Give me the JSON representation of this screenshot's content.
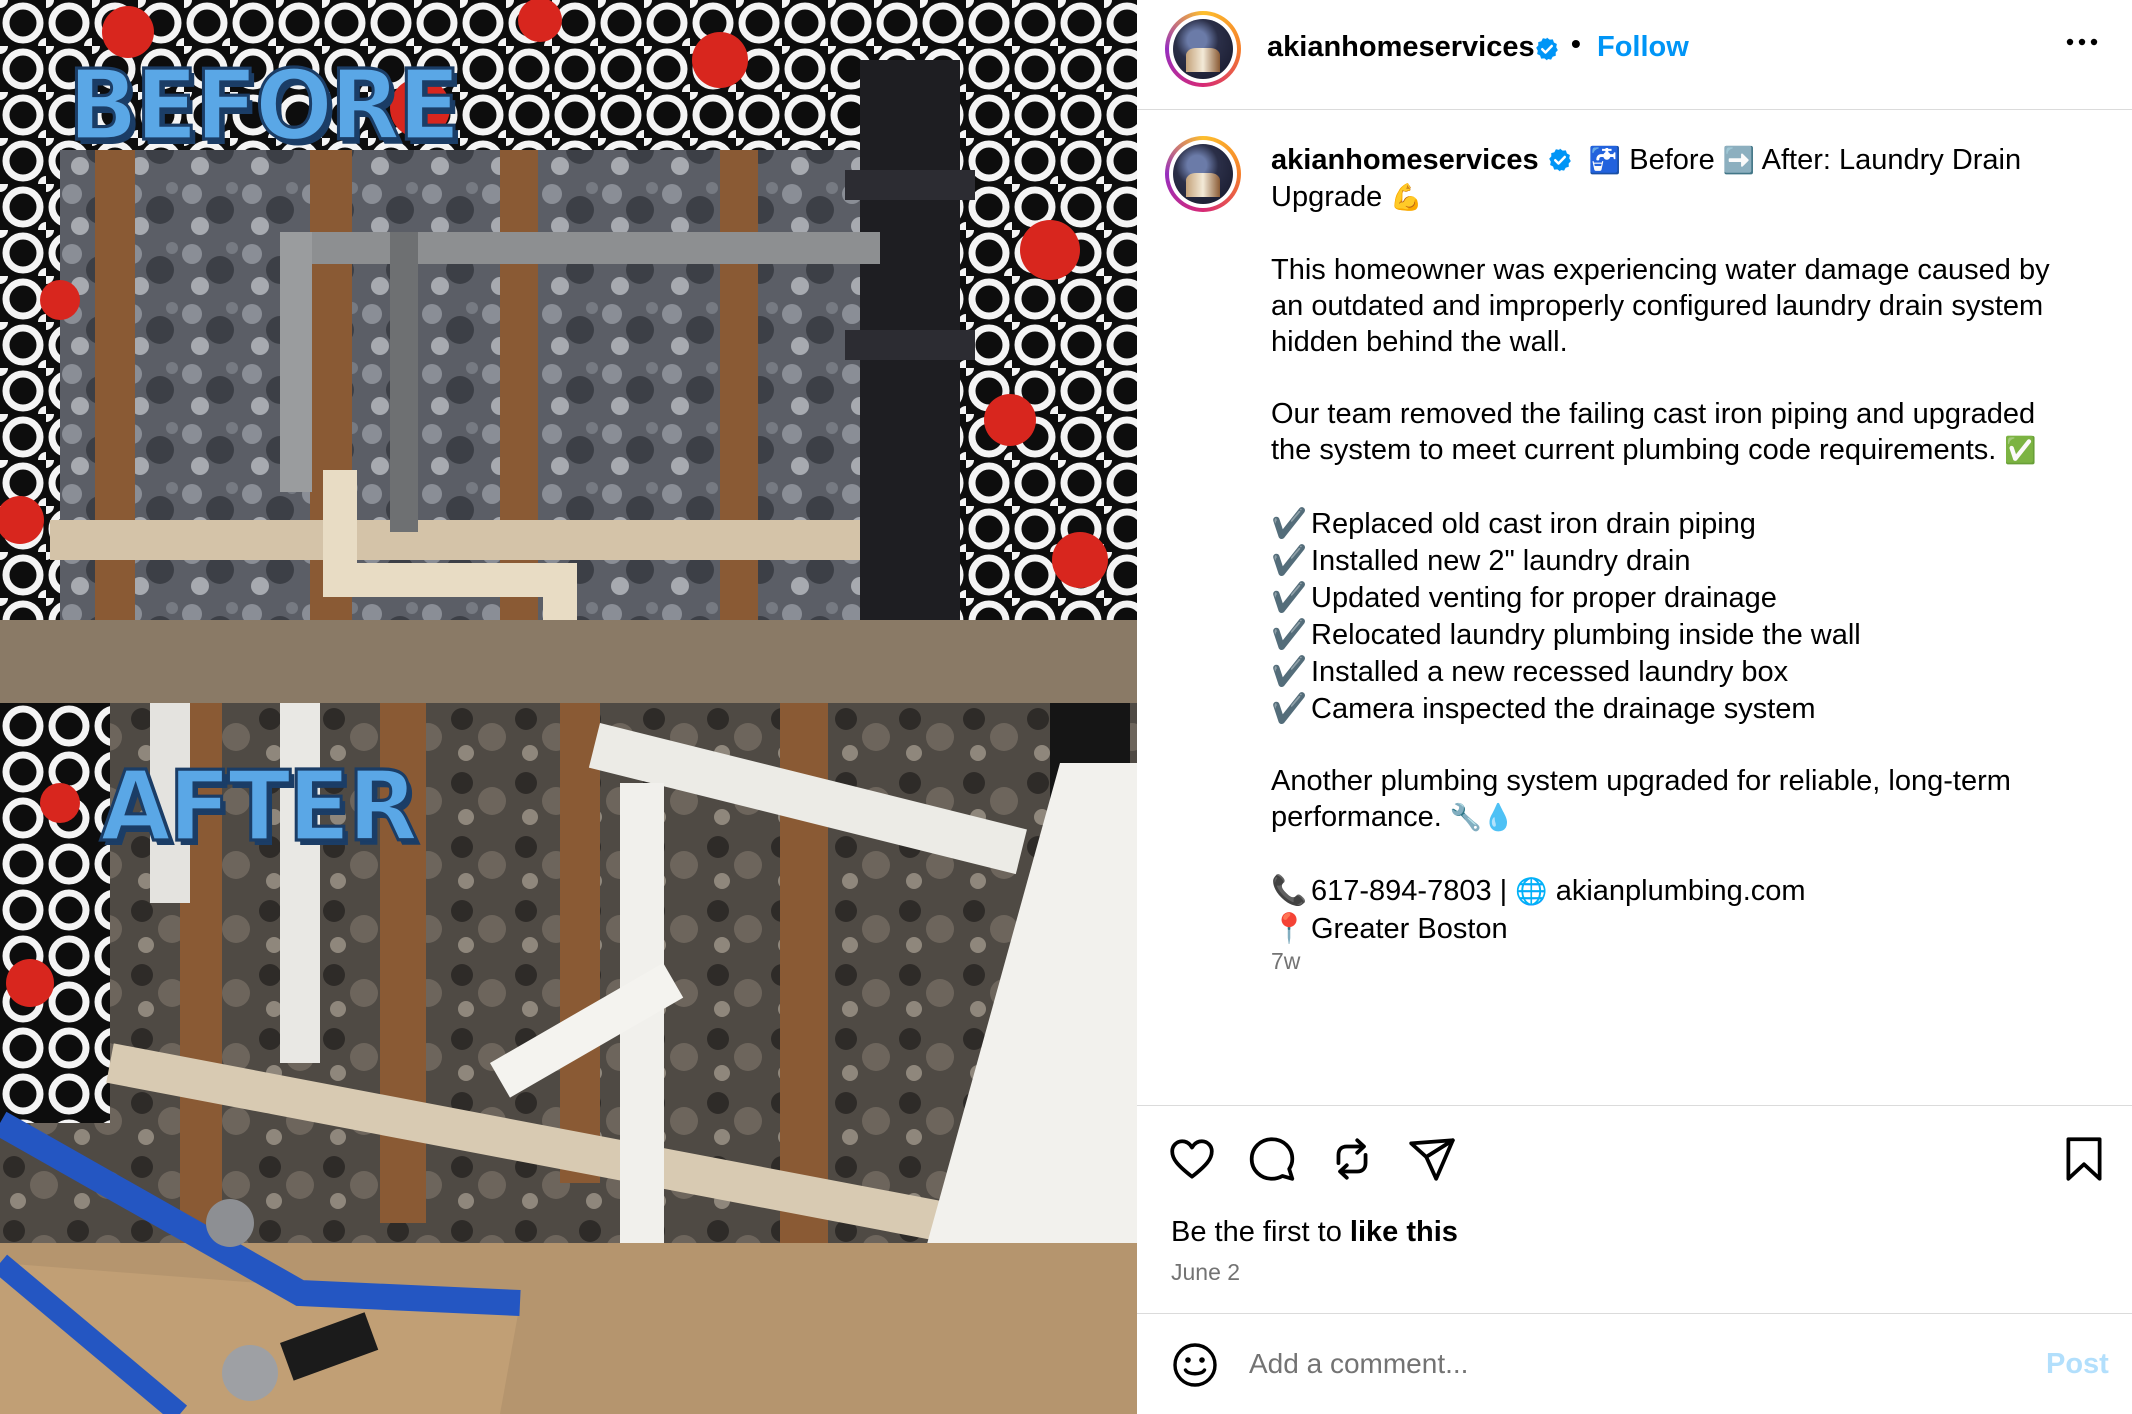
{
  "media": {
    "before_label": "BEFORE",
    "after_label": "AFTER"
  },
  "header": {
    "username": "akianhomeservices",
    "separator": "•",
    "follow_label": "Follow",
    "more_icon": "more-options-icon"
  },
  "caption": {
    "username": "akianhomeservices",
    "title_parts": {
      "faucet_emoji": "🚰",
      "before": "Before",
      "arrow_emoji": "➡️",
      "after": "After: Laundry Drain",
      "line2": "Upgrade",
      "muscle_emoji": "💪"
    },
    "paragraph1": [
      "This homeowner was experiencing water damage caused by",
      "an outdated and improperly configured laundry drain system",
      "hidden behind the wall."
    ],
    "paragraph2": [
      "Our team removed the failing cast iron piping and upgraded",
      "the system to meet current plumbing code requirements."
    ],
    "check_emoji": "✅",
    "tick_mark": "✔️",
    "checklist": [
      "Replaced old cast iron drain piping",
      "Installed new 2\" laundry drain",
      "Updated venting for proper drainage",
      "Relocated laundry plumbing inside the wall",
      "Installed a new recessed laundry box",
      "Camera inspected the drainage system"
    ],
    "closing": [
      "Another plumbing system upgraded for reliable, long-term",
      "performance."
    ],
    "closing_emojis": [
      "🔧",
      "💧"
    ],
    "contact": {
      "phone_emoji": "📞",
      "phone": "617-894-7803 |",
      "globe_emoji": "🌐",
      "website": "akianplumbing.com",
      "pin_emoji": "📍",
      "location": "Greater Boston"
    },
    "age": "7w"
  },
  "actions": {
    "likes_prefix": "Be the first to",
    "likes_bold": "like this",
    "date": "June 2"
  },
  "comment": {
    "placeholder": "Add a comment...",
    "post_label": "Post"
  },
  "colors": {
    "follow": "#0095f6",
    "verified": "#0095f6",
    "post_disabled": "#b2dffc",
    "muted": "#737373",
    "divider": "#dbdbdb"
  }
}
